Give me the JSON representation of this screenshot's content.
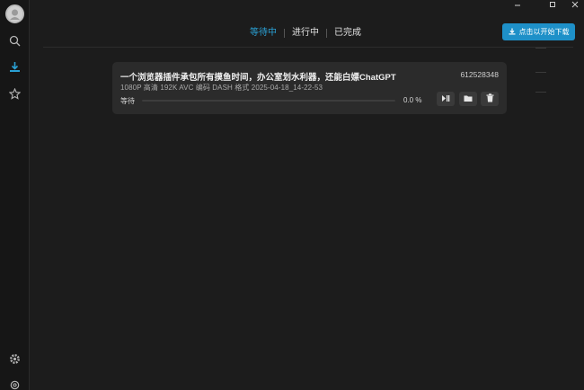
{
  "colors": {
    "accent": "#1e90c8",
    "tab_active": "#2aa0d4",
    "background": "#1c1c1c",
    "card": "#2b2b2b"
  },
  "sidebar": {
    "items": [
      {
        "icon": "search-icon"
      },
      {
        "icon": "download-icon",
        "active": true
      },
      {
        "icon": "star-icon"
      }
    ],
    "bottom": [
      {
        "icon": "settings-icon"
      },
      {
        "icon": "gear-icon"
      }
    ]
  },
  "window": {
    "controls": [
      "minimize-icon",
      "maximize-icon",
      "close-icon"
    ]
  },
  "tabs": [
    {
      "label": "等待中",
      "active": true
    },
    {
      "label": "进行中",
      "active": false
    },
    {
      "label": "已完成",
      "active": false
    }
  ],
  "toolbar": {
    "download_all_label": "点击以开始下载"
  },
  "tasks": [
    {
      "title": "一个浏览器插件承包所有摸鱼时间，办公室划水利器，还能白嫖ChatGPT",
      "id": "612528348",
      "meta": "1080P 高清  192K  AVC 编码  DASH 格式  2025-04-18_14-22-53",
      "status": "等待",
      "progress": 0.0,
      "percent_text": "0.0 %",
      "actions": [
        "play-pause-icon",
        "folder-icon",
        "trash-icon"
      ]
    }
  ]
}
